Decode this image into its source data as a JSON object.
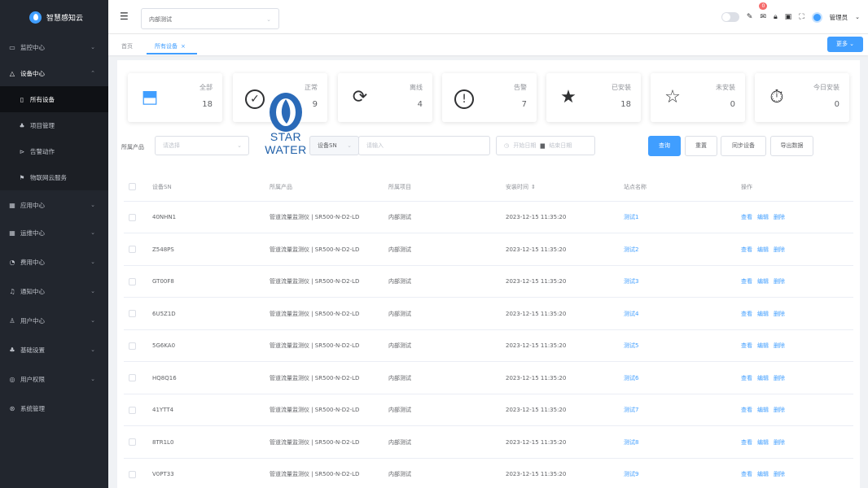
{
  "brand": {
    "name": "智慧感知云"
  },
  "sidebar": {
    "items": [
      {
        "label": "监控中心",
        "icon": "monitor-icon",
        "glyph": "▭"
      },
      {
        "label": "设备中心",
        "icon": "device-icon",
        "glyph": "△"
      },
      {
        "label": "所有设备",
        "icon": "device-list-icon",
        "glyph": "▯"
      },
      {
        "label": "项目管理",
        "icon": "project-icon",
        "glyph": "♣"
      },
      {
        "label": "告警动作",
        "icon": "alarm-action-icon",
        "glyph": "⊳"
      },
      {
        "label": "物联网云服务",
        "icon": "flag-icon",
        "glyph": "⚑"
      },
      {
        "label": "应用中心",
        "icon": "app-icon",
        "glyph": "▦"
      },
      {
        "label": "运维中心",
        "icon": "ops-icon",
        "glyph": "▦"
      },
      {
        "label": "费用中心",
        "icon": "fee-icon",
        "glyph": "◔"
      },
      {
        "label": "通知中心",
        "icon": "bell-icon",
        "glyph": "♫"
      },
      {
        "label": "用户中心",
        "icon": "user-icon",
        "glyph": "♙"
      },
      {
        "label": "基础设置",
        "icon": "settings-base-icon",
        "glyph": "♣"
      },
      {
        "label": "用户权限",
        "icon": "permission-icon",
        "glyph": "◎"
      },
      {
        "label": "系统管理",
        "icon": "system-icon",
        "glyph": "⊛"
      }
    ]
  },
  "header": {
    "project_value": "内部测试",
    "notification_count": "0",
    "user_name": "管理员"
  },
  "tabs": {
    "home": "首页",
    "current": "所有设备"
  },
  "ops_button": "更多",
  "stats": [
    {
      "label": "全部",
      "value": "18",
      "icon": "box-icon",
      "glyph": "⬒"
    },
    {
      "label": "正常",
      "value": "9",
      "icon": "check-circle-icon",
      "glyph": "✓"
    },
    {
      "label": "离线",
      "value": "4",
      "icon": "refresh-icon",
      "glyph": "⟳"
    },
    {
      "label": "告警",
      "value": "7",
      "icon": "alert-circle-icon",
      "glyph": "!"
    },
    {
      "label": "已安装",
      "value": "18",
      "icon": "star-filled-icon",
      "glyph": "★"
    },
    {
      "label": "未安装",
      "value": "0",
      "icon": "star-outline-icon",
      "glyph": "☆"
    },
    {
      "label": "今日安装",
      "value": "0",
      "icon": "stopwatch-icon",
      "glyph": "⏱"
    }
  ],
  "filters": {
    "product_label": "所属产品",
    "product_placeholder": "请选择",
    "sn_type": "设备SN",
    "sn_placeholder": "请输入",
    "start_date": "开始日期",
    "end_date": "结束日期",
    "query": "查询",
    "reset": "重置",
    "sync": "同步设备",
    "export": "导出数据"
  },
  "watermark": {
    "text": "STAR WATER"
  },
  "table": {
    "headers": [
      "设备SN",
      "所属产品",
      "所属项目",
      "安装时间",
      "站点名称",
      "操作"
    ],
    "sort_icon": "⇕",
    "actions": [
      "查看",
      "编辑",
      "删除"
    ],
    "rows": [
      {
        "sn": "40NHN1",
        "product": "管道流量监测仪 | SR500-N-D2-LD",
        "project": "内部测试",
        "time": "2023-12-15 11:35:20",
        "site": "测试1"
      },
      {
        "sn": "Z548PS",
        "product": "管道流量监测仪 | SR500-N-D2-LD",
        "project": "内部测试",
        "time": "2023-12-15 11:35:20",
        "site": "测试2"
      },
      {
        "sn": "GT00F8",
        "product": "管道流量监测仪 | SR500-N-D2-LD",
        "project": "内部测试",
        "time": "2023-12-15 11:35:20",
        "site": "测试3"
      },
      {
        "sn": "6U5Z1D",
        "product": "管道流量监测仪 | SR500-N-D2-LD",
        "project": "内部测试",
        "time": "2023-12-15 11:35:20",
        "site": "测试4"
      },
      {
        "sn": "5G6KA0",
        "product": "管道流量监测仪 | SR500-N-D2-LD",
        "project": "内部测试",
        "time": "2023-12-15 11:35:20",
        "site": "测试5"
      },
      {
        "sn": "HQ8Q16",
        "product": "管道流量监测仪 | SR500-N-D2-LD",
        "project": "内部测试",
        "time": "2023-12-15 11:35:20",
        "site": "测试6"
      },
      {
        "sn": "41YTT4",
        "product": "管道流量监测仪 | SR500-N-D2-LD",
        "project": "内部测试",
        "time": "2023-12-15 11:35:20",
        "site": "测试7"
      },
      {
        "sn": "8TR1L0",
        "product": "管道流量监测仪 | SR500-N-D2-LD",
        "project": "内部测试",
        "time": "2023-12-15 11:35:20",
        "site": "测试8"
      },
      {
        "sn": "V0PT33",
        "product": "管道流量监测仪 | SR500-N-D2-LD",
        "project": "内部测试",
        "time": "2023-12-15 11:35:20",
        "site": "测试9"
      }
    ]
  }
}
